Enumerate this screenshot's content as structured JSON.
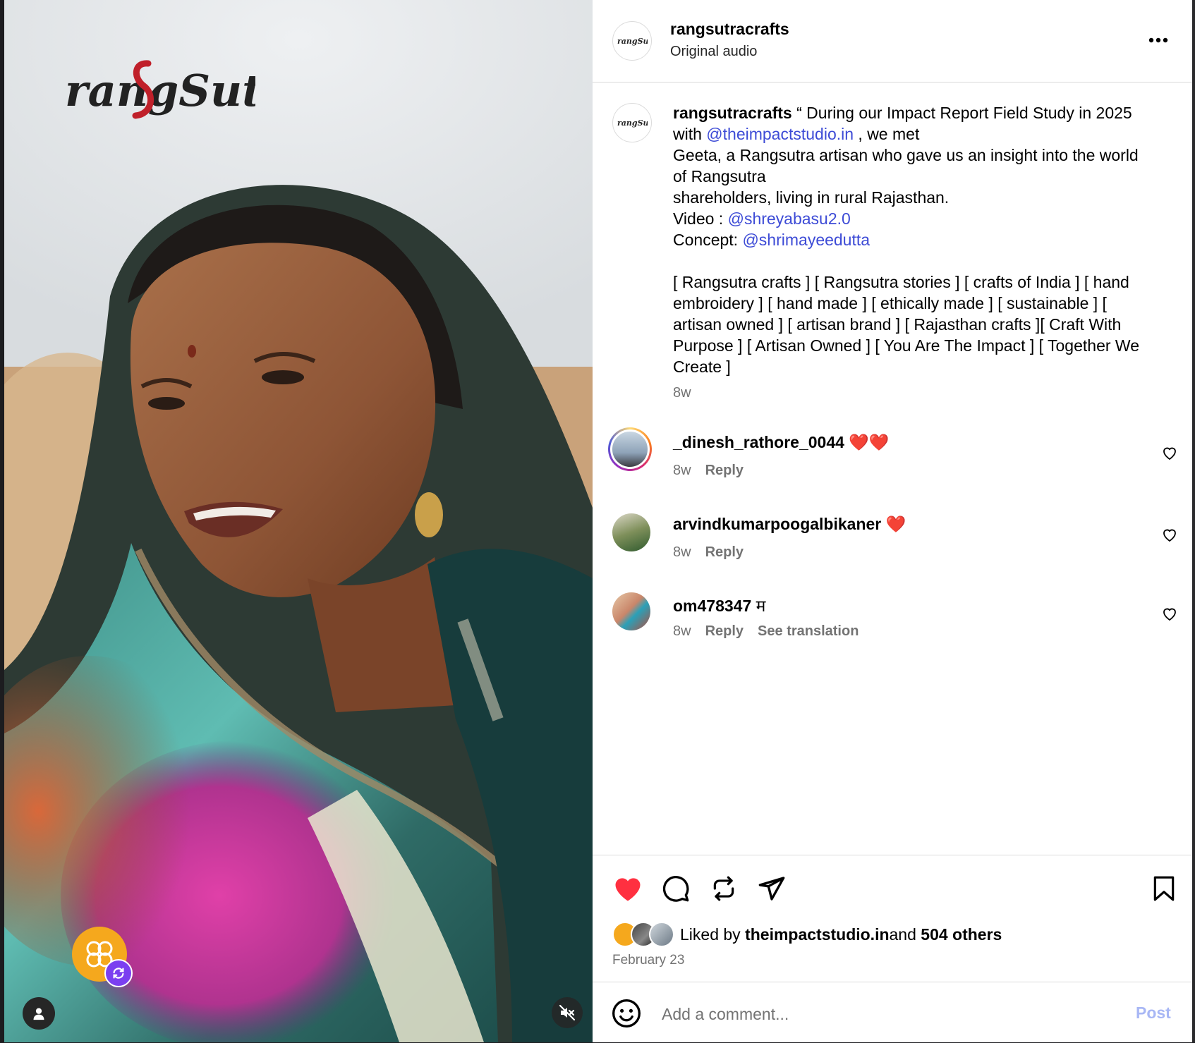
{
  "media": {
    "brand_logo_text": "rangSutra",
    "reel_avatar_icon": "rangsutra-knot-icon",
    "reel_badge_icon": "remix-icon",
    "tag_icon": "person-icon",
    "mute_icon": "speaker-muted-icon"
  },
  "header": {
    "username": "rangsutracrafts",
    "subtitle": "Original audio",
    "more_icon": "more-horizontal-icon"
  },
  "caption": {
    "username": "rangsutracrafts",
    "line1_pre": " “ During our Impact Report Field Study in 2025 with ",
    "mention1": "@theimpactstudio.in",
    "line1_post": " , we met\nGeeta, a Rangsutra artisan who gave us an insight into the world of Rangsutra\nshareholders, living in rural Rajasthan.\nVideo : ",
    "mention2": "@shreyabasu2.0",
    "concept_pre": "\nConcept: ",
    "mention3": "@shrimayeedutta",
    "hashtags": "\n\n[ Rangsutra crafts ] [ Rangsutra stories ] [ crafts of India ] [ hand embroidery ] [ hand made ] [ ethically made ] [ sustainable ] [ artisan owned ] [ artisan brand ] [ Rajasthan crafts ][ Craft With Purpose ] [ Artisan Owned ] [ You Are The Impact ] [ Together We Create ]",
    "time": "8w"
  },
  "comments": [
    {
      "username": "_dinesh_rathore_0044",
      "text": " ❤️❤️",
      "time": "8w",
      "reply": "Reply",
      "translate": ""
    },
    {
      "username": "arvindkumarpoogalbikaner",
      "text": " ❤️",
      "time": "8w",
      "reply": "Reply",
      "translate": ""
    },
    {
      "username": "om478347",
      "text": " म",
      "time": "8w",
      "reply": "Reply",
      "translate": "See translation"
    }
  ],
  "actions": {
    "like_icon": "heart-filled-icon",
    "comment_icon": "comment-icon",
    "repost_icon": "repost-icon",
    "share_icon": "send-icon",
    "save_icon": "bookmark-icon",
    "liked_prefix": "Liked by ",
    "liked_user": "theimpactstudio.in",
    "liked_and": " and ",
    "liked_others": "504 others",
    "date": "February 23"
  },
  "comment_box": {
    "placeholder": "Add a comment...",
    "post_label": "Post",
    "emoji_icon": "emoji-icon"
  },
  "colors": {
    "like_red": "#ff3040",
    "mention_blue": "#3d4bd6",
    "muted_gray": "#737373",
    "post_disabled": "#a8b7f5"
  }
}
